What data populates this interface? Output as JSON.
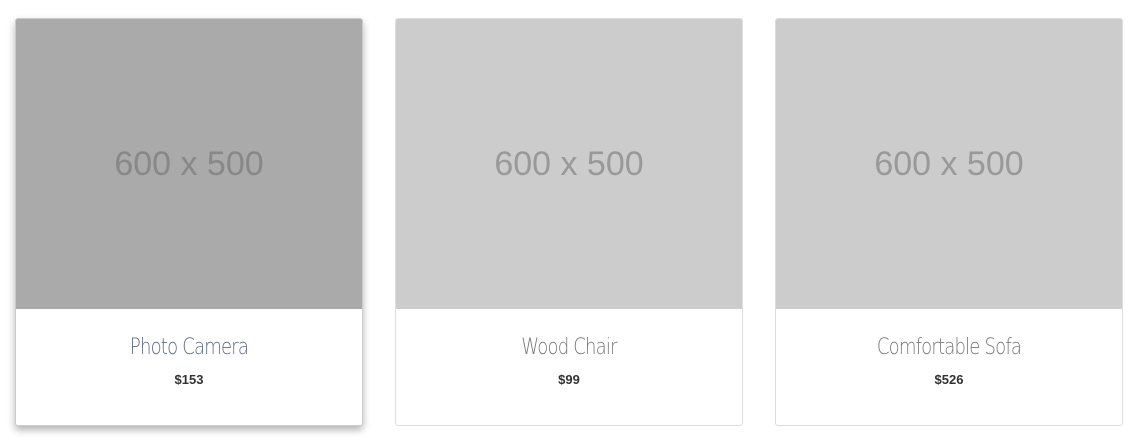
{
  "products": [
    {
      "image_label": "600 x 500",
      "name": "Photo Camera",
      "price": "$153",
      "hovered": true
    },
    {
      "image_label": "600 x 500",
      "name": "Wood Chair",
      "price": "$99",
      "hovered": false
    },
    {
      "image_label": "600 x 500",
      "name": "Comfortable Sofa",
      "price": "$526",
      "hovered": false
    }
  ]
}
